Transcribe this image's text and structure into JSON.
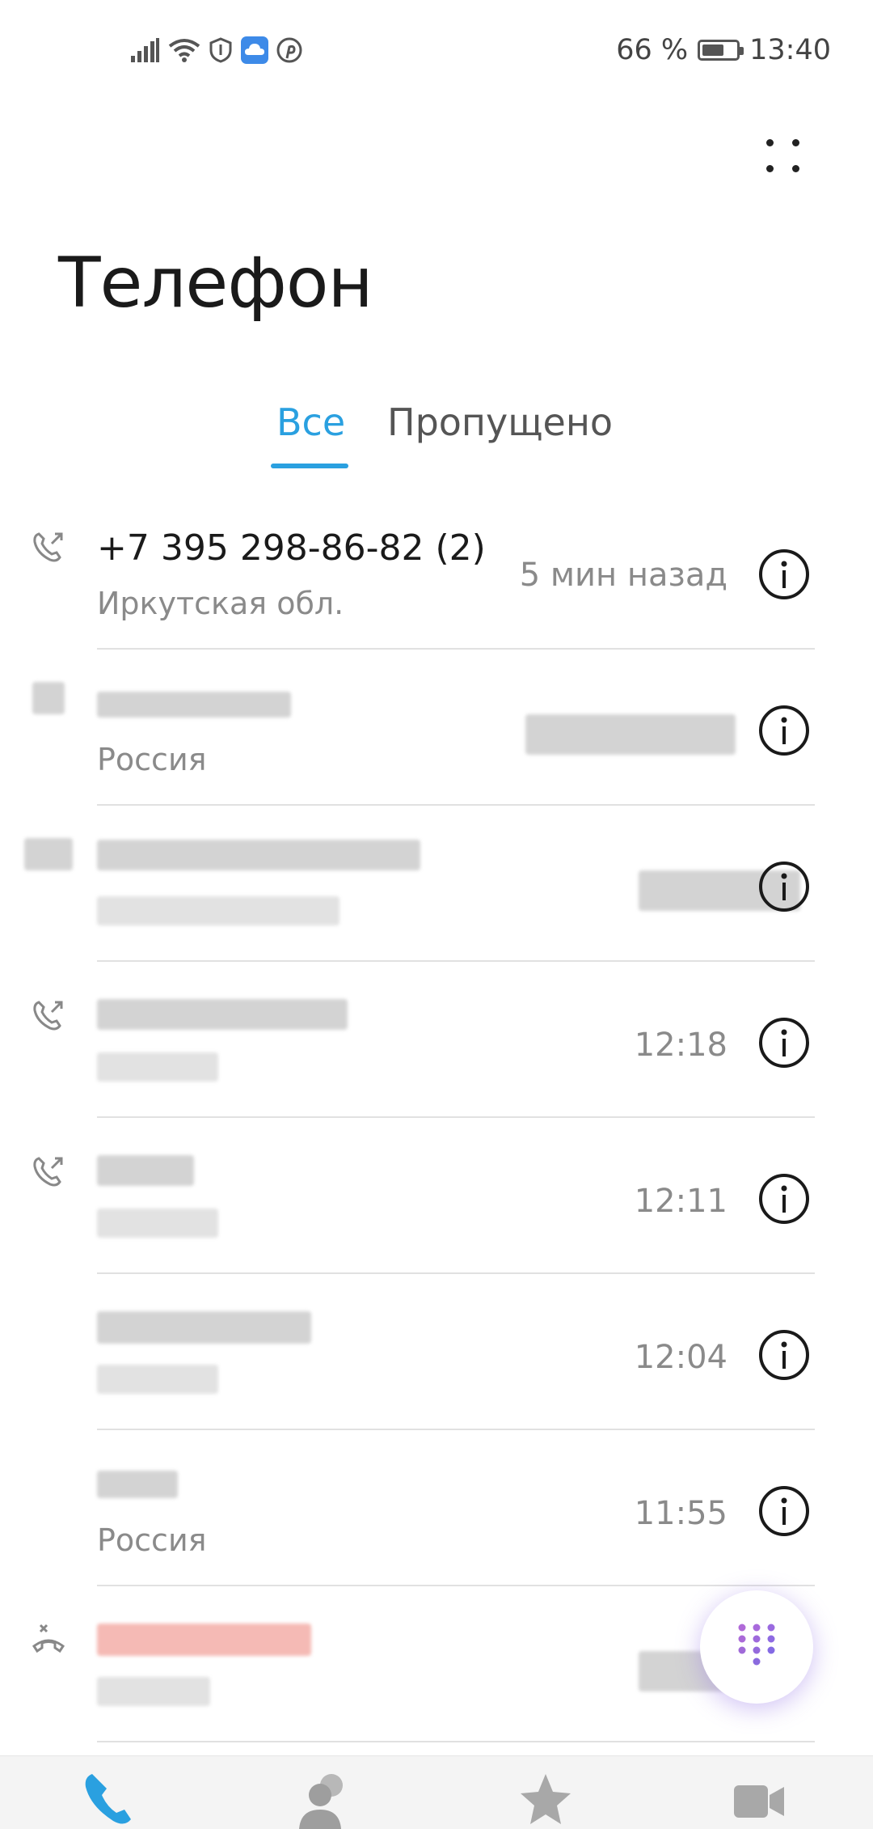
{
  "status_bar": {
    "battery_text": "66 %",
    "battery_level": 0.66,
    "time": "13:40",
    "icons": [
      "signal-icon",
      "wifi-icon",
      "shield-icon",
      "cloud-app-icon",
      "pinterest-icon"
    ]
  },
  "header": {
    "title": "Телефон",
    "menu_icon": "more-dots-icon"
  },
  "tabs": [
    {
      "label": "Все",
      "active": true
    },
    {
      "label": "Пропущено",
      "active": false
    }
  ],
  "calls": [
    {
      "name": "+7 395 298-86-82 (2)",
      "region": "Иркутская обл.",
      "time": "5 мин назад",
      "type": "outgoing",
      "redacted": false
    },
    {
      "name": "",
      "region": "Россия",
      "time": "",
      "type": "outgoing",
      "redacted": true
    },
    {
      "name": "",
      "region": "",
      "time": "",
      "type": "outgoing",
      "redacted": true
    },
    {
      "name": "",
      "region": "",
      "time": "12:18",
      "type": "outgoing",
      "redacted": true
    },
    {
      "name": "",
      "region": "",
      "time": "12:11",
      "type": "outgoing",
      "redacted": true
    },
    {
      "name": "",
      "region": "",
      "time": "12:04",
      "type": "none",
      "redacted": true
    },
    {
      "name": "",
      "region": "Россия",
      "time": "11:55",
      "type": "none",
      "redacted": true
    },
    {
      "name": "",
      "region": "",
      "time": "",
      "type": "missed",
      "redacted": true
    }
  ],
  "fab": {
    "icon": "dialpad-icon"
  },
  "bottom_nav": [
    {
      "icon": "phone-icon",
      "active": true
    },
    {
      "icon": "contacts-icon",
      "active": false
    },
    {
      "icon": "star-icon",
      "active": false
    },
    {
      "icon": "video-call-icon",
      "active": false
    }
  ],
  "colors": {
    "accent": "#2aa0e0",
    "missed": "#e0483a",
    "secondary_text": "#8a8a8a"
  }
}
